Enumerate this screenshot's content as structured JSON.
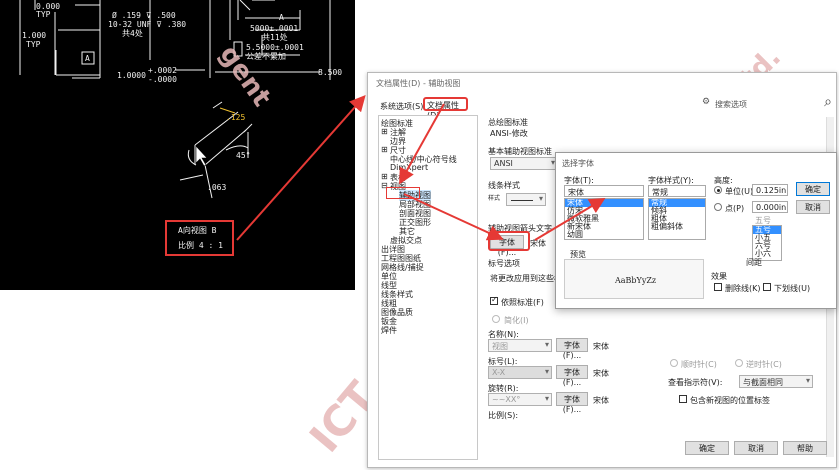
{
  "cad": {
    "texts": {
      "dim_top_left": "0.000",
      "typ_1": "TYP",
      "dim_1000": "1.000",
      "typ_2": "TYP",
      "hole_dia": "Ø .159 ⊽ .500",
      "thread": "10-32 UNF ⊽ .380",
      "hole_count": "共4处",
      "label_a_top": "A",
      "dim_5000": "5000±.0001",
      "count_11": "共11处",
      "dim_55000": "5.5000±.0001",
      "dim_note": "公差不累加",
      "dim_8500": "8.500",
      "tol_plus": "+.0002",
      "tol_minus": "-.0000",
      "dim_10000": "1.0000",
      "label_a_box": "A",
      "dim_125": ".125",
      "angle_45": "45°",
      "dim_063": ".063",
      "view_label": "A向视图  B",
      "scale_label": "比例 4 : 1"
    },
    "colors": {
      "bg": "#000000",
      "line": "#f2f2f2",
      "accent": "#f0c030",
      "red": "#e53935"
    }
  },
  "watermark": {
    "text_top": "gent",
    "text_right": "Ltd.",
    "text_bottom": "ICT"
  },
  "dialog": {
    "title": "文档属性(D) - 辅助视图",
    "tabs": {
      "system": "系统选项(S)",
      "document": "文档属性(D)"
    },
    "search": {
      "icon": "search-icon",
      "placeholder": "搜索选项"
    },
    "tree": [
      "绘图标准",
      "注解",
      "边界",
      "尺寸",
      "中心线/中心符号线",
      "DimXpert",
      "表格",
      "视图",
      "辅助视图",
      "局部视图",
      "剖面视图",
      "正交图形",
      "其它",
      "虚拟交点",
      "出详图",
      "工程图图纸",
      "网格线/捕捉",
      "单位",
      "线型",
      "线条样式",
      "线粗",
      "图像品质",
      "钣金",
      "焊件"
    ],
    "section_overall": "总绘图标准",
    "overall_value": "ANSI-修改",
    "section_base": "基本辅助视图标准",
    "base_value": "ANSI",
    "section_line": "线条样式",
    "line_style_hint": "样式",
    "section_arrow_text": "辅助视图箭头文字",
    "font_button": "字体(F)...",
    "font_value": "宋体",
    "section_label": "标号选项",
    "label_desc": "将更改应用到这些标准",
    "follow_standard": "依照标准(F)",
    "simple": "简化(I)",
    "name_label": "名称(N):",
    "name_value": "视图",
    "name_font": "宋体",
    "mark_label": "标号(L):",
    "mark_value": "X-X",
    "mark_font": "宋体",
    "rotate_label": "旋转(R):",
    "rotate_value": "~~XX°",
    "rotate_font": "宋体",
    "scale_label": "比例(S):",
    "ccw": "逆时针(C)",
    "cw": "顺时针(C)",
    "view_indicator_label": "查看指示符(V):",
    "view_indicator_value": "与截面相同",
    "include_position": "包含新视图的位置标签",
    "ok": "确定",
    "cancel": "取消",
    "help": "帮助"
  },
  "font_picker": {
    "title": "选择字体",
    "font_label": "字体(T):",
    "font_value": "宋体",
    "font_list": [
      "宋体",
      "仿宋",
      "微软雅黑",
      "新宋体",
      "幼圆"
    ],
    "style_label": "字体样式(Y):",
    "style_value": "常规",
    "style_list": [
      "常规",
      "倾斜",
      "粗体",
      "粗偏斜体"
    ],
    "height_label": "高度:",
    "unit_label": "单位(U)",
    "unit_value": "0.125in",
    "point_label": "点(P)",
    "point_value": "0.000in",
    "size_label": "五号",
    "size_list": [
      "五号",
      "小五",
      "六号",
      "小六"
    ],
    "spacing_label": "间距",
    "preview_label": "预览",
    "preview_text": "AaBbYyZz",
    "effects_label": "效果",
    "strikeout": "删除线(K)",
    "underline": "下划线(U)",
    "ok": "确定",
    "cancel": "取消"
  },
  "annotations": {
    "highlight_color": "#e53935"
  }
}
